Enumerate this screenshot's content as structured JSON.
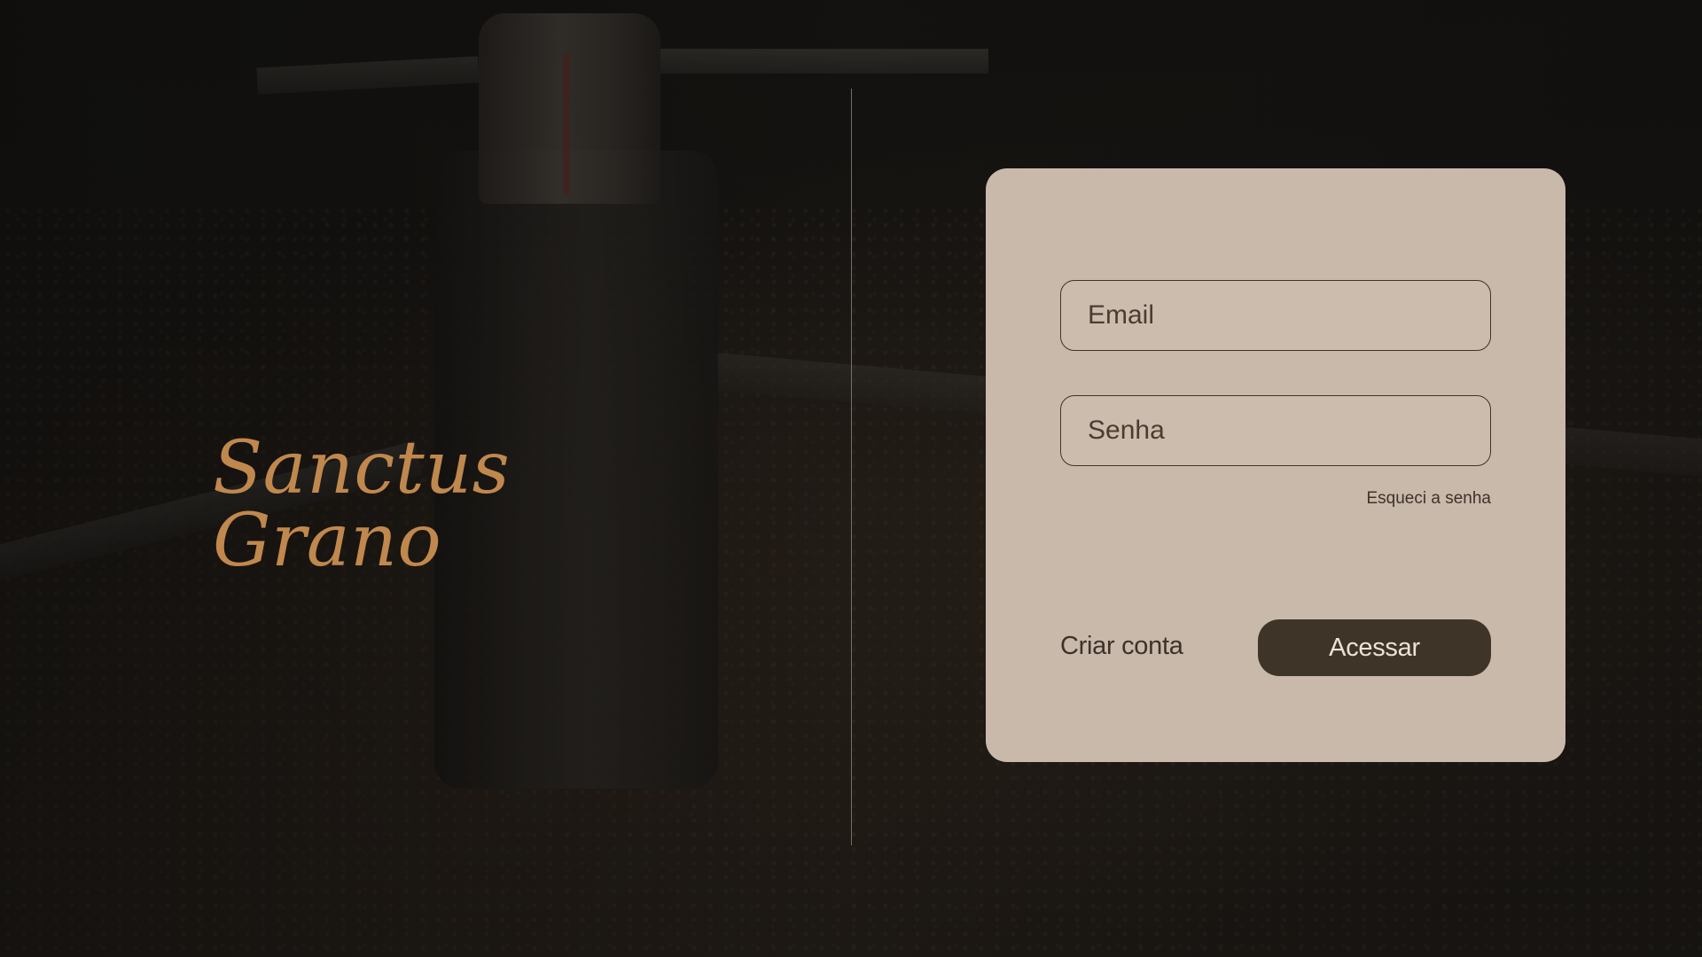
{
  "brand": {
    "name": "Sanctus Grano"
  },
  "login": {
    "email_placeholder": "Email",
    "password_placeholder": "Senha",
    "forgot_password": "Esqueci a senha",
    "create_account": "Criar conta",
    "submit_label": "Acessar"
  },
  "colors": {
    "brand_text": "#c0884d",
    "card_background": "#c9b9ab",
    "button_background": "#3e3427",
    "button_text": "#ece3d8"
  }
}
